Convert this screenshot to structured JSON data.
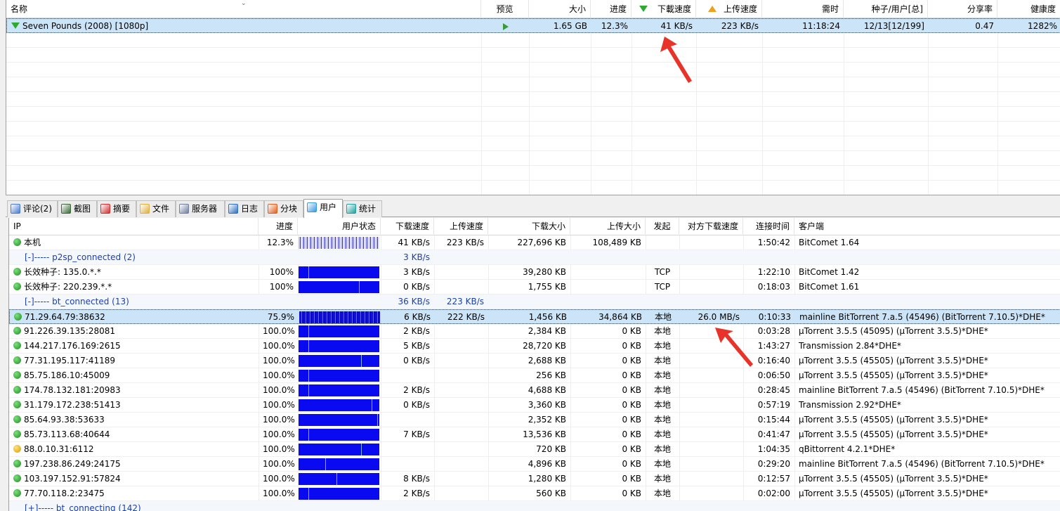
{
  "tasks": {
    "columns": {
      "name": "名称",
      "preview": "预览",
      "size": "大小",
      "progress": "进度",
      "download_speed": "下載速度",
      "upload_speed": "上传速度",
      "remaining": "需时",
      "seeds_peers": "种子/用户[总]",
      "share_ratio": "分享率",
      "health": "健康度"
    },
    "rows": [
      {
        "name": "Seven Pounds (2008) [1080p]",
        "size": "1.65 GB",
        "progress": "12.3%",
        "download_speed": "41 KB/s",
        "upload_speed": "223 KB/s",
        "remaining": "11:18:24",
        "seeds_peers": "12/13[12/199]",
        "share_ratio": "0.47",
        "health": "1282%"
      }
    ]
  },
  "tabs": [
    {
      "label": "评论(2)",
      "icon": "comment-icon",
      "color": "#4a7bd0"
    },
    {
      "label": "截图",
      "icon": "screenshot-icon",
      "color": "#3a6a3a"
    },
    {
      "label": "摘要",
      "icon": "summary-icon",
      "color": "#d03030"
    },
    {
      "label": "文件",
      "icon": "file-icon",
      "color": "#e0b040"
    },
    {
      "label": "服务器",
      "icon": "server-icon",
      "color": "#7080a0"
    },
    {
      "label": "日志",
      "icon": "log-icon",
      "color": "#3070c0"
    },
    {
      "label": "分块",
      "icon": "pie-icon",
      "color": "#e06020"
    },
    {
      "label": "用户",
      "icon": "user-icon",
      "color": "#3a9ae0"
    },
    {
      "label": "统计",
      "icon": "stats-icon",
      "color": "#20a0a0"
    }
  ],
  "active_tab": 7,
  "peers": {
    "columns": {
      "ip": "IP",
      "progress": "进度",
      "status": "用户状态",
      "download_speed": "下载速度",
      "upload_speed": "上传速度",
      "downloaded": "下载大小",
      "uploaded": "上传大小",
      "initiated_by": "发起",
      "peer_download_speed": "对方下载速度",
      "connected_time": "连接时间",
      "client": "客户端"
    },
    "rows": [
      {
        "kind": "peer",
        "icon": "dot",
        "ip": "本机",
        "progress": "12.3%",
        "bar": "partial",
        "download_speed": "41 KB/s",
        "upload_speed": "223 KB/s",
        "downloaded": "227,696 KB",
        "uploaded": "108,489 KB",
        "initiated_by": "",
        "peer_download_speed": "",
        "connected_time": "1:50:42",
        "client": "BitComet 1.64"
      },
      {
        "kind": "group",
        "ip": "[-]----- p2sp_connected (2)",
        "download_speed": "3 KB/s",
        "upload_speed": ""
      },
      {
        "kind": "peer",
        "icon": "dot",
        "ip": "长效种子: 135.0.*.*",
        "progress": "100%",
        "bar": "full",
        "mark": 0.12,
        "download_speed": "3 KB/s",
        "upload_speed": "",
        "downloaded": "39,280 KB",
        "uploaded": "",
        "initiated_by": "TCP",
        "peer_download_speed": "",
        "connected_time": "1:22:10",
        "client": "BitComet 1.42"
      },
      {
        "kind": "peer",
        "icon": "dot",
        "ip": "长效种子: 220.239.*.*",
        "progress": "100%",
        "bar": "full",
        "mark": 0.75,
        "download_speed": "0 KB/s",
        "upload_speed": "",
        "downloaded": "1,755 KB",
        "uploaded": "",
        "initiated_by": "TCP",
        "peer_download_speed": "",
        "connected_time": "0:18:03",
        "client": "BitComet 1.61"
      },
      {
        "kind": "group",
        "ip": "[-]----- bt_connected (13)",
        "download_speed": "36 KB/s",
        "upload_speed": "223 KB/s"
      },
      {
        "kind": "peer",
        "selected": true,
        "icon": "dot",
        "ip": "71.29.64.79:38632",
        "progress": "75.9%",
        "bar": "dense",
        "download_speed": "6 KB/s",
        "upload_speed": "222 KB/s",
        "downloaded": "1,456 KB",
        "uploaded": "34,864 KB",
        "initiated_by": "本地",
        "peer_download_speed": "26.0 MB/s",
        "connected_time": "0:10:33",
        "client": "mainline BitTorrent 7.a.5 (45496) (BitTorrent 7.10.5)*DHE*"
      },
      {
        "kind": "peer",
        "icon": "dot",
        "ip": "91.226.39.135:28081",
        "progress": "100.0%",
        "bar": "full",
        "mark": 0.12,
        "download_speed": "2 KB/s",
        "upload_speed": "",
        "downloaded": "2,384 KB",
        "uploaded": "0 KB",
        "initiated_by": "本地",
        "peer_download_speed": "",
        "connected_time": "0:03:28",
        "client": "µTorrent 3.5.5 (45095) (µTorrent 3.5.5)*DHE*"
      },
      {
        "kind": "peer",
        "icon": "dot",
        "ip": "144.217.176.169:2615",
        "progress": "100.0%",
        "bar": "full",
        "mark": 0.12,
        "download_speed": "5 KB/s",
        "upload_speed": "",
        "downloaded": "28,720 KB",
        "uploaded": "0 KB",
        "initiated_by": "本地",
        "peer_download_speed": "",
        "connected_time": "1:43:27",
        "client": "Transmission 2.84*DHE*"
      },
      {
        "kind": "peer",
        "icon": "dot",
        "ip": "77.31.195.117:41189",
        "progress": "100.0%",
        "bar": "full",
        "mark": 0.77,
        "download_speed": "0 KB/s",
        "upload_speed": "",
        "downloaded": "2,688 KB",
        "uploaded": "0 KB",
        "initiated_by": "本地",
        "peer_download_speed": "",
        "connected_time": "0:16:40",
        "client": "µTorrent 3.5.5 (45505) (µTorrent 3.5.5)*DHE*"
      },
      {
        "kind": "peer",
        "icon": "dot",
        "ip": "85.75.186.10:45009",
        "progress": "100.0%",
        "bar": "full",
        "mark": 0.12,
        "download_speed": "",
        "upload_speed": "",
        "downloaded": "256 KB",
        "uploaded": "0 KB",
        "initiated_by": "本地",
        "peer_download_speed": "",
        "connected_time": "0:06:50",
        "client": "µTorrent 3.5.5 (45505) (µTorrent 3.5.5)*DHE*"
      },
      {
        "kind": "peer",
        "icon": "dot",
        "ip": "174.78.132.181:20983",
        "progress": "100.0%",
        "bar": "full",
        "mark": 0.12,
        "download_speed": "2 KB/s",
        "upload_speed": "",
        "downloaded": "4,688 KB",
        "uploaded": "0 KB",
        "initiated_by": "本地",
        "peer_download_speed": "",
        "connected_time": "0:28:45",
        "client": "mainline BitTorrent 7.a.5 (45496) (BitTorrent 7.10.5)*DHE*"
      },
      {
        "kind": "peer",
        "icon": "dot",
        "ip": "31.179.172.238:51413",
        "progress": "100.0%",
        "bar": "full",
        "mark": 0.9,
        "download_speed": "0 KB/s",
        "upload_speed": "",
        "downloaded": "3,360 KB",
        "uploaded": "0 KB",
        "initiated_by": "本地",
        "peer_download_speed": "",
        "connected_time": "0:57:19",
        "client": "Transmission 2.92*DHE*"
      },
      {
        "kind": "peer",
        "icon": "dot",
        "ip": "85.64.93.38:53633",
        "progress": "100.0%",
        "bar": "full",
        "mark": 0.97,
        "download_speed": "",
        "upload_speed": "",
        "downloaded": "2,352 KB",
        "uploaded": "0 KB",
        "initiated_by": "本地",
        "peer_download_speed": "",
        "connected_time": "0:15:44",
        "client": "µTorrent 3.5.5 (45505) (µTorrent 3.5.5)*DHE*"
      },
      {
        "kind": "peer",
        "icon": "dot",
        "ip": "85.73.113.68:40644",
        "progress": "100.0%",
        "bar": "full",
        "mark": 0.12,
        "download_speed": "7 KB/s",
        "upload_speed": "",
        "downloaded": "13,536 KB",
        "uploaded": "0 KB",
        "initiated_by": "本地",
        "peer_download_speed": "",
        "connected_time": "0:41:47",
        "client": "µTorrent 3.5.5 (45505) (µTorrent 3.5.5)*DHE*"
      },
      {
        "kind": "peer",
        "icon": "smile",
        "ip": "88.0.10.31:6112",
        "progress": "100.0%",
        "bar": "full",
        "mark": 0.77,
        "download_speed": "",
        "upload_speed": "",
        "downloaded": "720 KB",
        "uploaded": "0 KB",
        "initiated_by": "本地",
        "peer_download_speed": "",
        "connected_time": "1:04:35",
        "client": "qBittorrent 4.2.1*DHE*"
      },
      {
        "kind": "peer",
        "icon": "dot",
        "ip": "197.238.86.249:24175",
        "progress": "100.0%",
        "bar": "full",
        "mark": 0.33,
        "download_speed": "",
        "upload_speed": "",
        "downloaded": "4,896 KB",
        "uploaded": "0 KB",
        "initiated_by": "本地",
        "peer_download_speed": "",
        "connected_time": "0:29:20",
        "client": "mainline BitTorrent 7.a.5 (45496) (BitTorrent 7.10.5)*DHE*"
      },
      {
        "kind": "peer",
        "icon": "dot",
        "ip": "103.197.152.91:57824",
        "progress": "100.0%",
        "bar": "full",
        "mark": 0.47,
        "download_speed": "8 KB/s",
        "upload_speed": "",
        "downloaded": "1,280 KB",
        "uploaded": "0 KB",
        "initiated_by": "本地",
        "peer_download_speed": "",
        "connected_time": "0:12:57",
        "client": "µTorrent 3.5.5 (45505) (µTorrent 3.5.5)*DHE*"
      },
      {
        "kind": "peer",
        "icon": "dot",
        "ip": "77.70.118.2:23475",
        "progress": "100.0%",
        "bar": "full",
        "mark": 0.12,
        "download_speed": "2 KB/s",
        "upload_speed": "",
        "downloaded": "560 KB",
        "uploaded": "0 KB",
        "initiated_by": "本地",
        "peer_download_speed": "",
        "connected_time": "0:02:00",
        "client": "µTorrent 3.5.5 (45505) (µTorrent 3.5.5)*DHE*"
      },
      {
        "kind": "group",
        "ip": "[+]----- bt_connecting (142)",
        "download_speed": "",
        "upload_speed": ""
      }
    ]
  },
  "colors": {
    "selection": "#cce4f7",
    "group_text": "#1a3fb0",
    "bar_fill": "#0a0af0",
    "annotation_arrow": "#e8332a"
  }
}
